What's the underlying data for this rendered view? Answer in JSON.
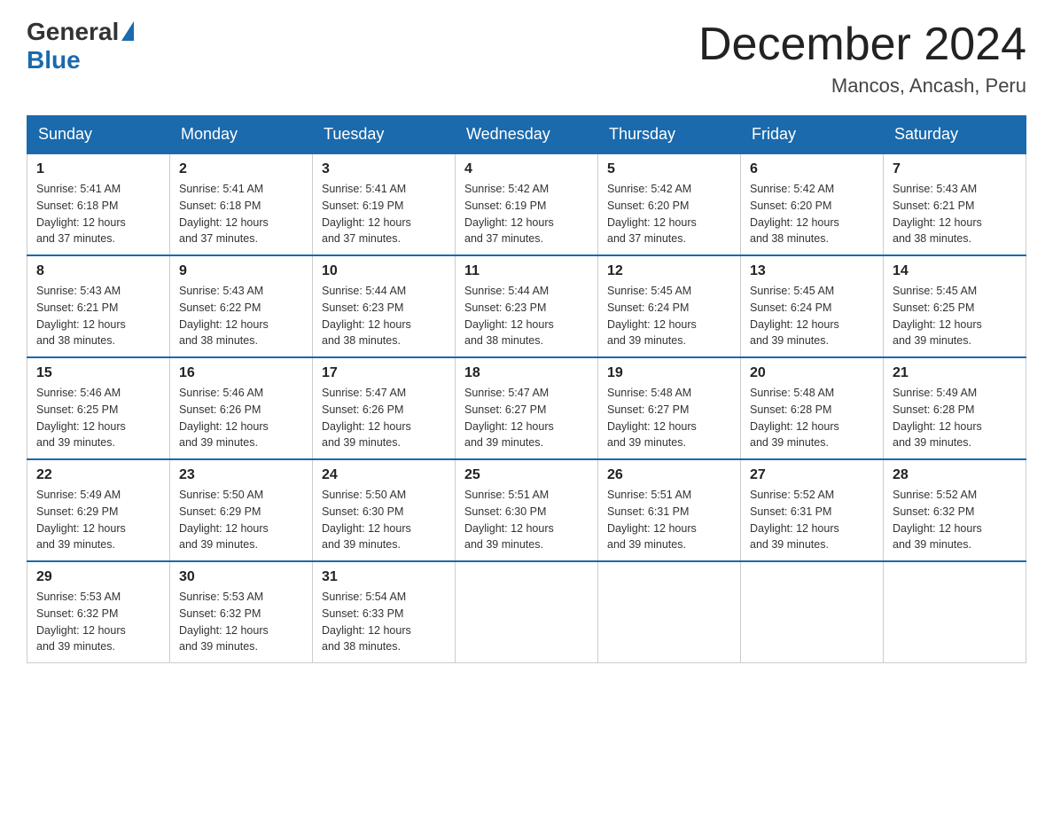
{
  "header": {
    "logo_general": "General",
    "logo_blue": "Blue",
    "month_title": "December 2024",
    "location": "Mancos, Ancash, Peru"
  },
  "days_of_week": [
    "Sunday",
    "Monday",
    "Tuesday",
    "Wednesday",
    "Thursday",
    "Friday",
    "Saturday"
  ],
  "weeks": [
    [
      {
        "day": "1",
        "sunrise": "5:41 AM",
        "sunset": "6:18 PM",
        "daylight": "12 hours and 37 minutes."
      },
      {
        "day": "2",
        "sunrise": "5:41 AM",
        "sunset": "6:18 PM",
        "daylight": "12 hours and 37 minutes."
      },
      {
        "day": "3",
        "sunrise": "5:41 AM",
        "sunset": "6:19 PM",
        "daylight": "12 hours and 37 minutes."
      },
      {
        "day": "4",
        "sunrise": "5:42 AM",
        "sunset": "6:19 PM",
        "daylight": "12 hours and 37 minutes."
      },
      {
        "day": "5",
        "sunrise": "5:42 AM",
        "sunset": "6:20 PM",
        "daylight": "12 hours and 37 minutes."
      },
      {
        "day": "6",
        "sunrise": "5:42 AM",
        "sunset": "6:20 PM",
        "daylight": "12 hours and 38 minutes."
      },
      {
        "day": "7",
        "sunrise": "5:43 AM",
        "sunset": "6:21 PM",
        "daylight": "12 hours and 38 minutes."
      }
    ],
    [
      {
        "day": "8",
        "sunrise": "5:43 AM",
        "sunset": "6:21 PM",
        "daylight": "12 hours and 38 minutes."
      },
      {
        "day": "9",
        "sunrise": "5:43 AM",
        "sunset": "6:22 PM",
        "daylight": "12 hours and 38 minutes."
      },
      {
        "day": "10",
        "sunrise": "5:44 AM",
        "sunset": "6:23 PM",
        "daylight": "12 hours and 38 minutes."
      },
      {
        "day": "11",
        "sunrise": "5:44 AM",
        "sunset": "6:23 PM",
        "daylight": "12 hours and 38 minutes."
      },
      {
        "day": "12",
        "sunrise": "5:45 AM",
        "sunset": "6:24 PM",
        "daylight": "12 hours and 39 minutes."
      },
      {
        "day": "13",
        "sunrise": "5:45 AM",
        "sunset": "6:24 PM",
        "daylight": "12 hours and 39 minutes."
      },
      {
        "day": "14",
        "sunrise": "5:45 AM",
        "sunset": "6:25 PM",
        "daylight": "12 hours and 39 minutes."
      }
    ],
    [
      {
        "day": "15",
        "sunrise": "5:46 AM",
        "sunset": "6:25 PM",
        "daylight": "12 hours and 39 minutes."
      },
      {
        "day": "16",
        "sunrise": "5:46 AM",
        "sunset": "6:26 PM",
        "daylight": "12 hours and 39 minutes."
      },
      {
        "day": "17",
        "sunrise": "5:47 AM",
        "sunset": "6:26 PM",
        "daylight": "12 hours and 39 minutes."
      },
      {
        "day": "18",
        "sunrise": "5:47 AM",
        "sunset": "6:27 PM",
        "daylight": "12 hours and 39 minutes."
      },
      {
        "day": "19",
        "sunrise": "5:48 AM",
        "sunset": "6:27 PM",
        "daylight": "12 hours and 39 minutes."
      },
      {
        "day": "20",
        "sunrise": "5:48 AM",
        "sunset": "6:28 PM",
        "daylight": "12 hours and 39 minutes."
      },
      {
        "day": "21",
        "sunrise": "5:49 AM",
        "sunset": "6:28 PM",
        "daylight": "12 hours and 39 minutes."
      }
    ],
    [
      {
        "day": "22",
        "sunrise": "5:49 AM",
        "sunset": "6:29 PM",
        "daylight": "12 hours and 39 minutes."
      },
      {
        "day": "23",
        "sunrise": "5:50 AM",
        "sunset": "6:29 PM",
        "daylight": "12 hours and 39 minutes."
      },
      {
        "day": "24",
        "sunrise": "5:50 AM",
        "sunset": "6:30 PM",
        "daylight": "12 hours and 39 minutes."
      },
      {
        "day": "25",
        "sunrise": "5:51 AM",
        "sunset": "6:30 PM",
        "daylight": "12 hours and 39 minutes."
      },
      {
        "day": "26",
        "sunrise": "5:51 AM",
        "sunset": "6:31 PM",
        "daylight": "12 hours and 39 minutes."
      },
      {
        "day": "27",
        "sunrise": "5:52 AM",
        "sunset": "6:31 PM",
        "daylight": "12 hours and 39 minutes."
      },
      {
        "day": "28",
        "sunrise": "5:52 AM",
        "sunset": "6:32 PM",
        "daylight": "12 hours and 39 minutes."
      }
    ],
    [
      {
        "day": "29",
        "sunrise": "5:53 AM",
        "sunset": "6:32 PM",
        "daylight": "12 hours and 39 minutes."
      },
      {
        "day": "30",
        "sunrise": "5:53 AM",
        "sunset": "6:32 PM",
        "daylight": "12 hours and 39 minutes."
      },
      {
        "day": "31",
        "sunrise": "5:54 AM",
        "sunset": "6:33 PM",
        "daylight": "12 hours and 38 minutes."
      },
      null,
      null,
      null,
      null
    ]
  ],
  "labels": {
    "sunrise": "Sunrise:",
    "sunset": "Sunset:",
    "daylight": "Daylight:"
  }
}
